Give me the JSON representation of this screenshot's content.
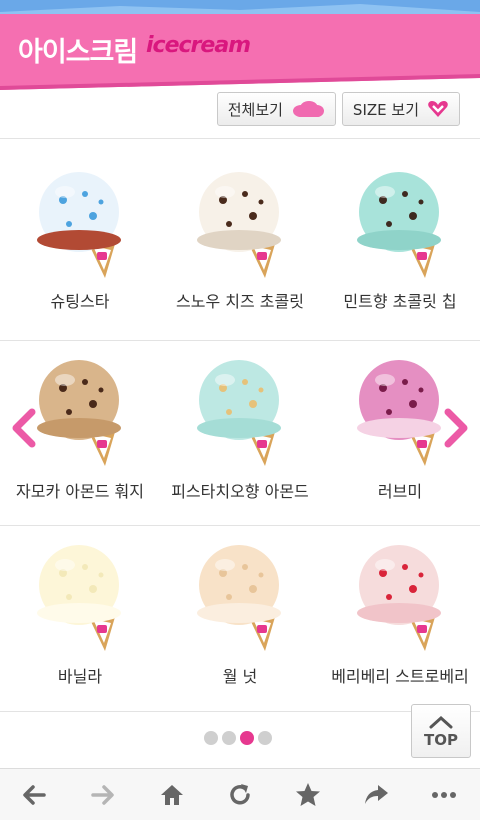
{
  "header": {
    "title": "아이스크림",
    "subtitle": "icecream",
    "brand_color": "#f56fb1",
    "subtitle_color": "#d9177e"
  },
  "toolbar": {
    "all_label": "전체보기",
    "size_label": "SIZE 보기"
  },
  "products": [
    {
      "name": "슈팅스타",
      "colors": [
        "#e9f3fb",
        "#4da3df",
        "#b24a34"
      ]
    },
    {
      "name": "스노우 치즈 초콜릿",
      "colors": [
        "#f7f1e8",
        "#4a2b1c",
        "#e0d4c4"
      ]
    },
    {
      "name": "민트향 초콜릿 칩",
      "colors": [
        "#a8e3da",
        "#3e2a20",
        "#8fd3c9"
      ]
    },
    {
      "name": "자모카 아몬드 훠지",
      "colors": [
        "#d9b58b",
        "#4a2a1a",
        "#c69a6a"
      ]
    },
    {
      "name": "피스타치오향 아몬드",
      "colors": [
        "#bde8e3",
        "#e6c27a",
        "#a5ddd6"
      ]
    },
    {
      "name": "러브미",
      "colors": [
        "#e58fc2",
        "#7a1c4a",
        "#f5d2e4"
      ]
    },
    {
      "name": "바닐라",
      "colors": [
        "#fdf6d8",
        "#f3e9b9",
        "#fffbea"
      ]
    },
    {
      "name": "월 넛",
      "colors": [
        "#f8e2c8",
        "#e8c59a",
        "#fbeedf"
      ]
    },
    {
      "name": "베리베리 스트로베리",
      "colors": [
        "#f6dcdc",
        "#d9243a",
        "#f1c4c9"
      ]
    }
  ],
  "pager": {
    "count": 4,
    "active": 2
  },
  "top_button": {
    "label": "TOP"
  },
  "browser_bar": {
    "icons": [
      "back-icon",
      "forward-icon",
      "home-icon",
      "refresh-icon",
      "bookmark-star-icon",
      "share-icon",
      "more-icon"
    ]
  },
  "accent_color": "#e6388f"
}
